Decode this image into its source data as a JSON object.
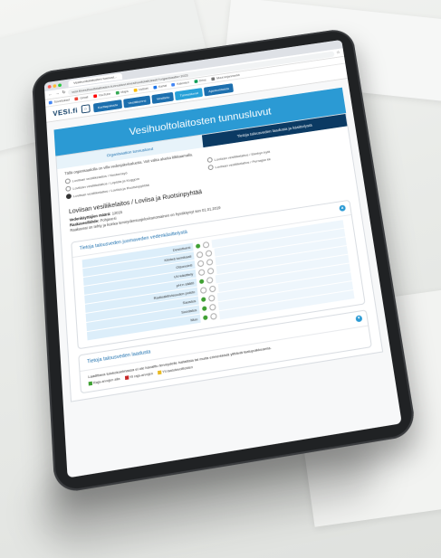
{
  "browser": {
    "tab_title": "Vesihuoltolaitosten tunnusl...",
    "url": "vesi.fi/vesihuoltolaitosten-tunnusluvut/vesihuoltolaitokset/?organisaatio=1023",
    "bookmarks": [
      "Sovellukset",
      "Gmail",
      "YouTube",
      "Maps",
      "Uutiset",
      "Kartat",
      "Kalenteri",
      "Drive",
      "Muut kirjanmerkit"
    ]
  },
  "site": {
    "logo": "VESI.fi",
    "nav": [
      "Karttapalvelu",
      "Vesiliikenne",
      "Vesitieto",
      "Tunnusluvut",
      "Ajankohtaista"
    ],
    "active_nav": 3
  },
  "banner": {
    "title": "Vesihuoltolaitosten tunnusluvut"
  },
  "tabs": {
    "org": "Organisaation tunnusluvut",
    "water": "Tietoja talousveden laadusta ja käsittelystä"
  },
  "choose_text": "Tällä organisaatiolla on villa vedenjakelualuetta. Voit valita alueita klikkaamalla.",
  "regions": [
    {
      "label": "Loviisan vesiliikelaitos / Noukensyö",
      "selected": false
    },
    {
      "label": "Loviisan vesiliikelaitos / Ekebyn kylä",
      "selected": false
    },
    {
      "label": "Loviisan vesiliikelaitos / Lepista ja Kuggom",
      "selected": false
    },
    {
      "label": "Loviisan vesiliikelaitos / Pernajan kk",
      "selected": false
    },
    {
      "label": "Loviisan vesiliikelaitos / Loviisa ja Ruotsinpyhtää",
      "selected": true
    }
  ],
  "plant": {
    "name": "Loviisan vesiliikelaitos / Loviisa ja Ruotsinpyhtää",
    "users_label": "Vedenkäyttäjien määrä:",
    "users_value": "12015",
    "source_label": "Raakavesilähde:",
    "source_value": "Pohjavesi",
    "note": "Raakavesi on tehty ja kuinka terveydensuojeluviranomainen on hyväksynyt sen 01.01.2019"
  },
  "quality_panel": {
    "title": "Tietoja talousveden juomaveden vedenkäsittelystä",
    "rows": [
      {
        "label": "Desinfiointi",
        "status": "green"
      },
      {
        "label": "Kiinteä kemikaali",
        "status": "empty"
      },
      {
        "label": "Otsonointi",
        "status": "empty"
      },
      {
        "label": "UV-käsittely",
        "status": "empty"
      },
      {
        "label": "pH:n säätö",
        "status": "green"
      },
      {
        "label": "Radioaktiivisuuden poisto",
        "status": "empty"
      },
      {
        "label": "Saostus",
        "status": "green"
      },
      {
        "label": "Suodatus",
        "status": "green"
      },
      {
        "label": "Muu",
        "status": "green"
      }
    ]
  },
  "panel2": {
    "title": "Tietoja talousveden laadusta",
    "text": "Laadittava tulokokoelmassa ei ole havaittu terveydelle haitallisia tai muita erimerkkisiä ylittäviä laatupoikkeamia.",
    "legend": [
      {
        "label": "Raja-arvojen alla",
        "color": "#3fa033"
      },
      {
        "label": "Yli raja-arvojen",
        "color": "#c62828"
      },
      {
        "label": "Yli laatutavoitteiden",
        "color": "#e8b923"
      }
    ]
  },
  "colors": {
    "accent": "#2b9ad4",
    "navy": "#0b3a63",
    "ok": "#3fa033"
  }
}
